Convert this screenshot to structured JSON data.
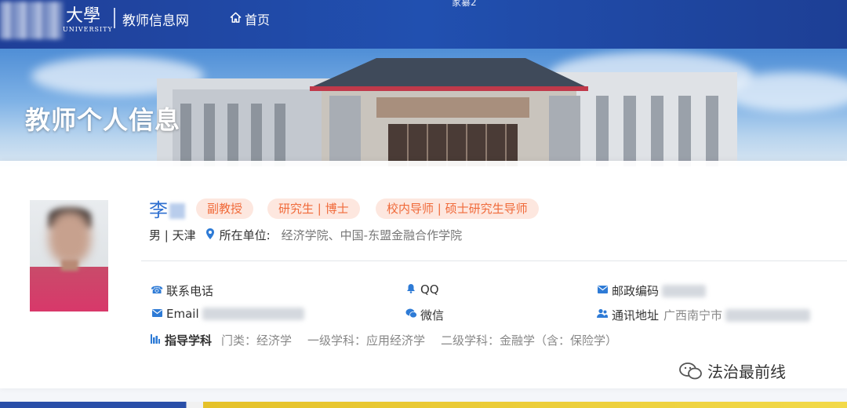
{
  "window": {
    "title": "家纂2"
  },
  "header": {
    "logo_char": "大學",
    "logo_sub": "UNIVERSITY",
    "site_title": "教师信息网",
    "home_label": "首页"
  },
  "banner": {
    "title": "教师个人信息"
  },
  "profile": {
    "name": "李",
    "tags": [
      "副教授",
      "研究生 | 博士",
      "校内导师 | 硕士研究生导师"
    ],
    "gender_place": "男 | 天津",
    "unit_label": "所在单位:",
    "unit_value": "经济学院、中国-东盟金融合作学院"
  },
  "contacts": {
    "phone_label": "联系电话",
    "qq_label": "QQ",
    "postcode_label": "邮政编码",
    "email_label": "Email",
    "wechat_label": "微信",
    "address_label": "通讯地址",
    "address_value": "广西南宁市"
  },
  "subject": {
    "label": "指导学科",
    "category": "门类：经济学",
    "level1": "一级学科：应用经济学",
    "level2": "二级学科：金融学（含：保险学）"
  },
  "watermark": {
    "text": "法治最前线"
  },
  "colors": {
    "nav": "#1f3f98",
    "accent_blue": "#2e6fd0",
    "tag_bg": "#fde7df",
    "tag_text": "#f06a3a"
  }
}
